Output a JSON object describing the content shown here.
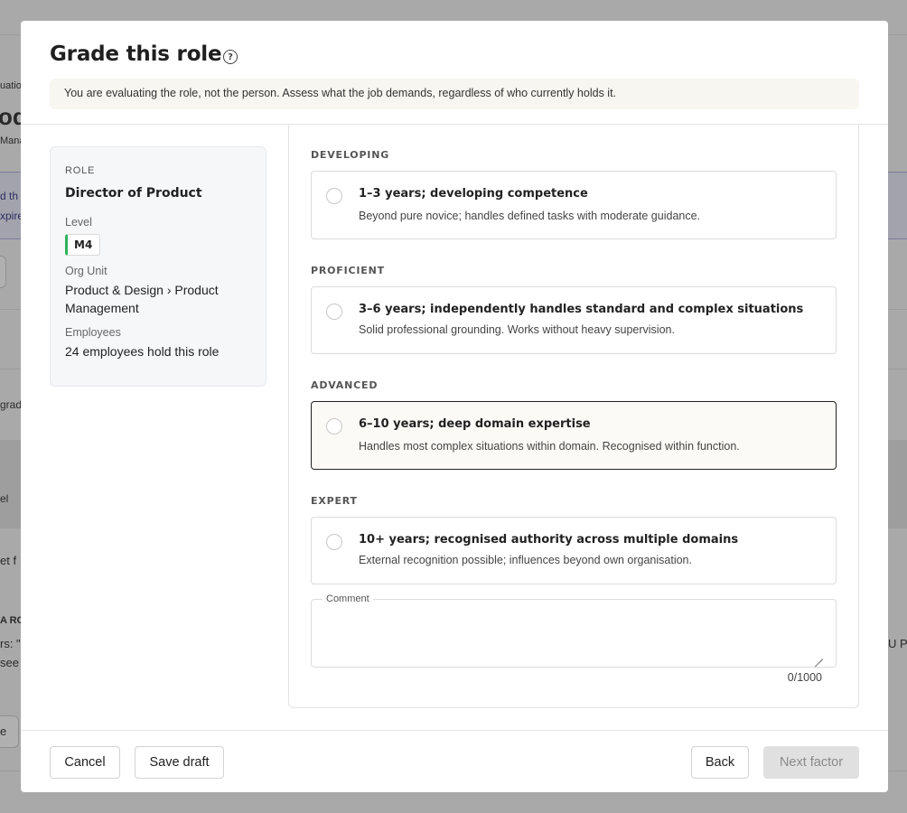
{
  "background": {
    "fragments": [
      "uatio",
      "od",
      "Mana",
      "d th",
      "xpire",
      "grad",
      "el",
      "et f",
      "A RO",
      "rs: \"",
      "see",
      "e",
      "U P"
    ]
  },
  "modal": {
    "title": "Grade this role",
    "help_icon": "question-circle-icon",
    "notice": "You are evaluating the role, not the person. Assess what the job demands, regardless of who currently holds it."
  },
  "role_card": {
    "caption": "ROLE",
    "name": "Director of Product",
    "level_label": "Level",
    "level_value": "M4",
    "level_color": "#2fb25a",
    "org_unit_label": "Org Unit",
    "org_unit_value": "Product & Design › Product Management",
    "employees_label": "Employees",
    "employees_value": "24 employees hold this role"
  },
  "factor": {
    "levels": [
      {
        "heading": "DEVELOPING",
        "title": "1–3 years; developing competence",
        "description": "Beyond pure novice; handles defined tasks with moderate guidance.",
        "highlighted": false
      },
      {
        "heading": "PROFICIENT",
        "title": "3–6 years; independently handles standard and complex situations",
        "description": "Solid professional grounding. Works without heavy supervision.",
        "highlighted": false
      },
      {
        "heading": "ADVANCED",
        "title": "6–10 years; deep domain expertise",
        "description": "Handles most complex situations within domain. Recognised within function.",
        "highlighted": true
      },
      {
        "heading": "EXPERT",
        "title": "10+ years; recognised authority across multiple domains",
        "description": "External recognition possible; influences beyond own organisation.",
        "highlighted": false
      }
    ],
    "comment_label": "Comment",
    "comment_value": "",
    "char_count": "0/1000"
  },
  "footer": {
    "cancel": "Cancel",
    "save_draft": "Save draft",
    "back": "Back",
    "next_factor": "Next factor"
  }
}
